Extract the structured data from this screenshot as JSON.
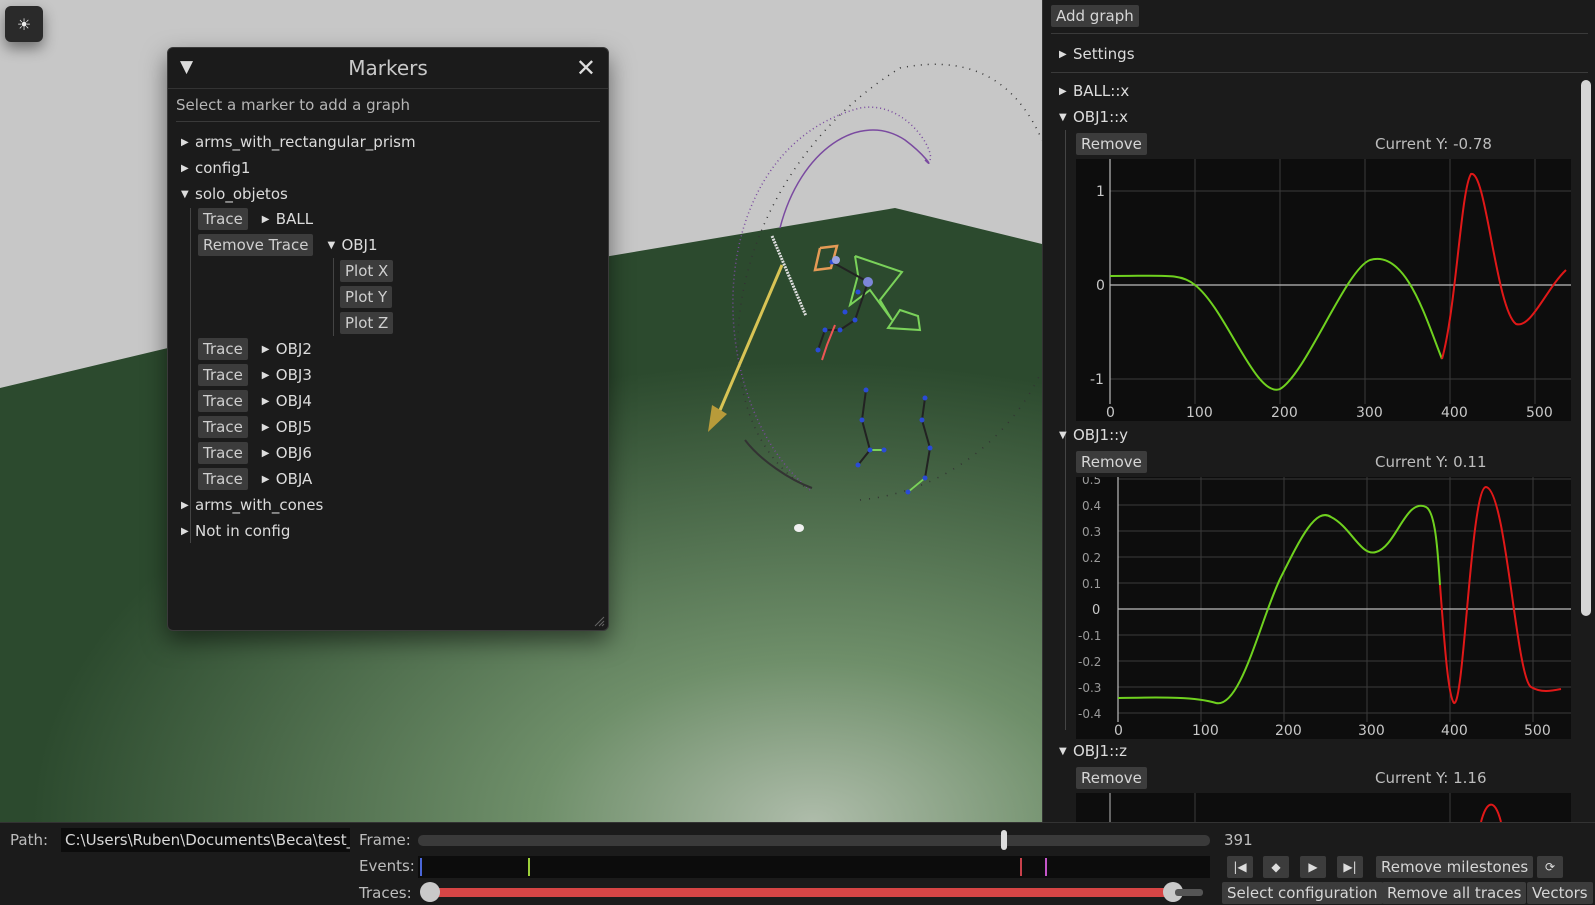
{
  "viewport": {
    "corner_icon": "sun-icon",
    "corner_glyph": "☀"
  },
  "markers": {
    "title": "Markers",
    "hint": "Select a marker to add a graph",
    "collapse_glyph": "▼",
    "close_glyph": "✕",
    "tree": {
      "arms_with_rectangular_prism": "arms_with_rectangular_prism",
      "config1": "config1",
      "solo_objetos": "solo_objetos",
      "arms_with_cones": "arms_with_cones",
      "not_in_config": "Not in config"
    },
    "trace_label": "Trace",
    "remove_trace_label": "Remove Trace",
    "objects": [
      "BALL",
      "OBJ1",
      "OBJ2",
      "OBJ3",
      "OBJ4",
      "OBJ5",
      "OBJ6",
      "OBJA"
    ],
    "plot_x": "Plot X",
    "plot_y": "Plot Y",
    "plot_z": "Plot Z"
  },
  "panel": {
    "add_graph": "Add graph",
    "settings": "Settings",
    "remove_label": "Remove",
    "graphs": [
      {
        "title": "BALL::x",
        "collapsed": true
      },
      {
        "title": "OBJ1::x",
        "current_y": "Current Y: -0.78",
        "yticks": [
          "1",
          "0",
          "-1"
        ],
        "xticks": [
          "0",
          "100",
          "200",
          "300",
          "400",
          "500"
        ]
      },
      {
        "title": "OBJ1::y",
        "current_y": "Current Y: 0.11",
        "yticks": [
          "0.5",
          "0.4",
          "0.3",
          "0.2",
          "0.1",
          "0",
          "-0.1",
          "-0.2",
          "-0.3",
          "-0.4"
        ],
        "xticks": [
          "0",
          "100",
          "200",
          "300",
          "400",
          "500"
        ]
      },
      {
        "title": "OBJ1::z",
        "current_y": "Current Y: 1.16"
      }
    ]
  },
  "bottom": {
    "path_label": "Path:",
    "path_value": "C:\\Users\\Ruben\\Documents\\Beca\\test_",
    "frame_label": "Frame:",
    "frame_value": "391",
    "events_label": "Events:",
    "traces_label": "Traces:",
    "remove_milestones": "Remove milestones",
    "select_configuration": "Select configuration",
    "remove_all_traces": "Remove all traces",
    "vectors": "Vectors",
    "frame_progress": 0.74,
    "colors": {
      "trace_slider": "#d64545",
      "event_blue": "#4a66d8",
      "event_green": "#9ccf3a",
      "event_red": "#c8414b",
      "event_magenta": "#c455c8"
    }
  }
}
